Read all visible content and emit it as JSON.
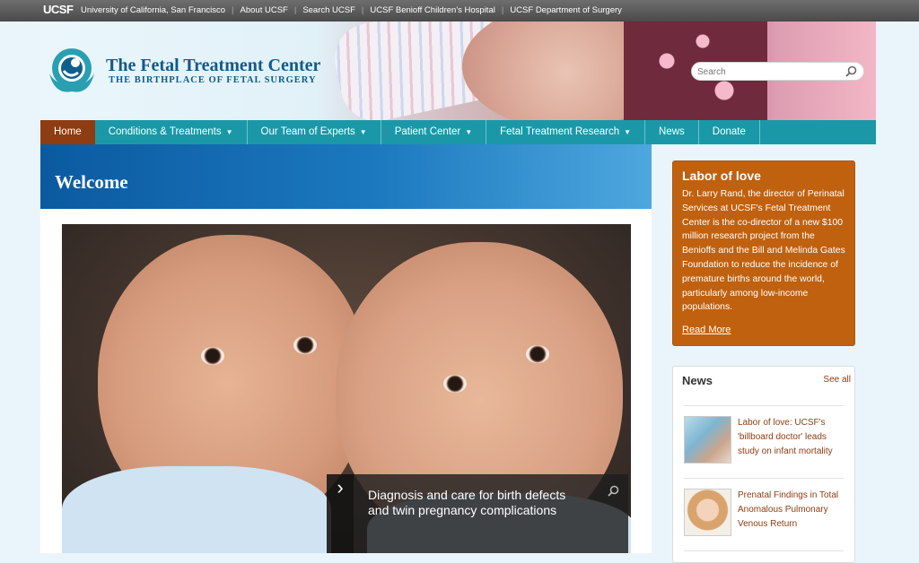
{
  "topbar": {
    "logo": "UCSF",
    "links": [
      "University of California, San Francisco",
      "About UCSF",
      "Search UCSF",
      "UCSF Benioff Children's Hospital",
      "UCSF Department of Surgery"
    ]
  },
  "header": {
    "title": "The Fetal Treatment Center",
    "tagline": "THE BIRTHPLACE OF FETAL SURGERY",
    "search_placeholder": "Search"
  },
  "nav": {
    "items": [
      {
        "label": "Home",
        "has_menu": false,
        "active": true
      },
      {
        "label": "Conditions & Treatments",
        "has_menu": true
      },
      {
        "label": "Our Team of Experts",
        "has_menu": true
      },
      {
        "label": "Patient Center",
        "has_menu": true
      },
      {
        "label": "Fetal Treatment Research",
        "has_menu": true
      },
      {
        "label": "News",
        "has_menu": false
      },
      {
        "label": "Donate",
        "has_menu": false
      }
    ],
    "caret": "▼"
  },
  "main": {
    "heading": "Welcome",
    "slide_caption": "Diagnosis and care for birth defects and twin pregnancy complications",
    "slide_next": "›"
  },
  "feature": {
    "title": "Labor of love",
    "body": "Dr. Larry Rand, the director of Perinatal Services at UCSF's Fetal Treatment Center is the co-director of a new $100 million research project from the Benioffs and the Bill and Melinda Gates Foundation to reduce the incidence of premature births around the world, particularly among low-income populations.",
    "link": "Read More"
  },
  "news": {
    "heading": "News",
    "see_all": "See all",
    "items": [
      {
        "title": "Labor of love: UCSF's 'billboard doctor' leads study on infant mortality"
      },
      {
        "title": "Prenatal Findings in Total Anomalous Pulmonary Venous Return"
      }
    ]
  },
  "colors": {
    "nav_bg": "#1a98a8",
    "nav_active": "#8e3c12",
    "feature_bg": "#c0610f",
    "welcome_bg": "#0b5aa0",
    "link": "#8e3c12"
  }
}
